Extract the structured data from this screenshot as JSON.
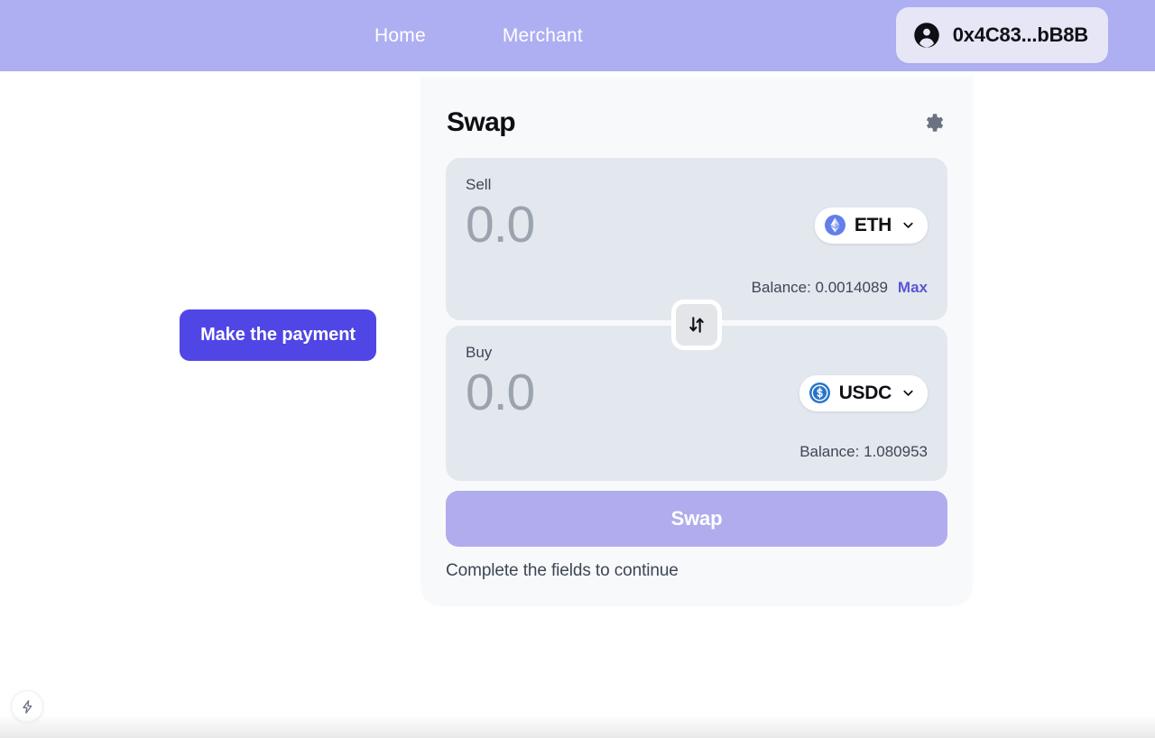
{
  "header": {
    "background_color": "#aeaef2",
    "nav_items": [
      {
        "label": "Home",
        "icon": "home-link"
      },
      {
        "label": "Merchant",
        "icon": "merchant-link"
      }
    ],
    "wallet": {
      "address": "0x4C83...bB8B",
      "icon": "account-circle-icon"
    }
  },
  "left_panel": {
    "pay_button_label": "Make the payment",
    "pay_button_color": "#4f46e5"
  },
  "swap_card": {
    "title": "Swap",
    "settings_icon": "gear-icon",
    "flip_icon": "swap-vertical-arrows-icon",
    "sell": {
      "label": "Sell",
      "amount_value": "",
      "amount_placeholder": "0.0",
      "token": {
        "symbol": "ETH",
        "icon": "ethereum-icon"
      },
      "balance_label": "Balance: 0.0014089",
      "max_label": "Max",
      "max_color": "#5b55d6"
    },
    "buy": {
      "label": "Buy",
      "amount_value": "",
      "amount_placeholder": "0.0",
      "token": {
        "symbol": "USDC",
        "icon": "usdc-icon"
      },
      "balance_label": "Balance: 1.080953"
    },
    "action": {
      "swap_button_label": "Swap",
      "swap_button_color": "#b0aced",
      "hint": "Complete the fields to continue"
    }
  },
  "floating_action": {
    "icon": "lightning-bolt-icon"
  }
}
